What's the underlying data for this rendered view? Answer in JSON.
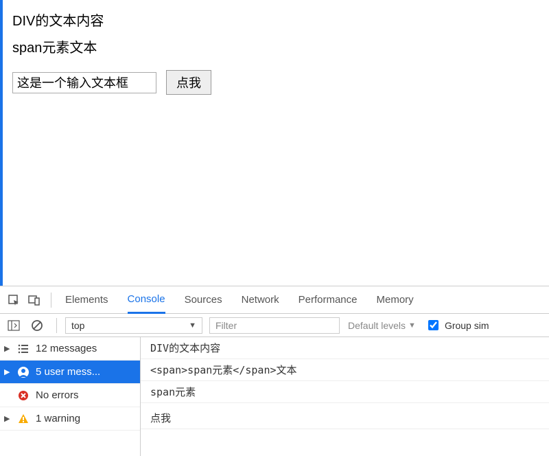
{
  "page": {
    "div_text": "DIV的文本内容",
    "span_text": "span元素文本",
    "input_value": "这是一个输入文本框",
    "button_label": "点我"
  },
  "devtools": {
    "tabs": {
      "elements": "Elements",
      "console": "Console",
      "sources": "Sources",
      "network": "Network",
      "performance": "Performance",
      "memory": "Memory"
    },
    "toolbar": {
      "context": "top",
      "filter_placeholder": "Filter",
      "levels_label": "Default levels",
      "group_label": "Group sim"
    },
    "sidebar": {
      "messages": {
        "count": 12,
        "label": "12 messages"
      },
      "user": {
        "count": 5,
        "label": "5 user mess..."
      },
      "errors": {
        "label": "No errors"
      },
      "warnings": {
        "count": 1,
        "label": "1 warning"
      }
    },
    "logs": [
      "DIV的文本内容",
      "<span>span元素</span>文本",
      "span元素",
      "",
      "点我"
    ]
  }
}
